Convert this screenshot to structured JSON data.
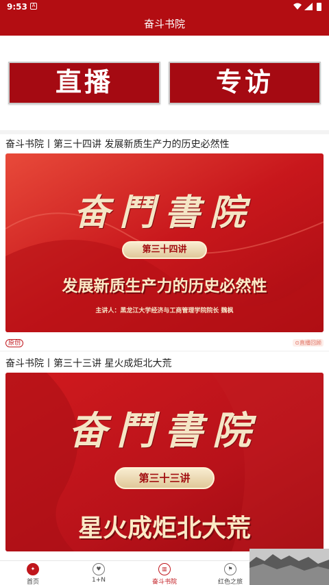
{
  "status": {
    "time": "9:53",
    "notif_icon": "A"
  },
  "header": {
    "title": "奋斗书院"
  },
  "buttons": {
    "live": "直播",
    "interview": "专访"
  },
  "articles": [
    {
      "title": "奋斗书院丨第三十四讲 发展新质生产力的历史必然性",
      "calligraphy": "奋鬥書院",
      "lecture": "第三十四讲",
      "subject": "发展新质生产力的历史必然性",
      "speaker": "主讲人：黑龙江大学经济与工商管理学院院长 魏枫",
      "tag_original": "原创",
      "tag_replay": "直播回顾"
    },
    {
      "title": "奋斗书院丨第三十三讲 星火成炬北大荒",
      "calligraphy": "奋鬥書院",
      "lecture": "第三十三讲",
      "subject": "星火成炬北大荒"
    }
  ],
  "tabbar": {
    "home": "首页",
    "one_plus_n": "1+N",
    "academy": "奋斗书院",
    "red_tour": "红色之旅"
  },
  "colors": {
    "brand_red": "#b30d12",
    "banner_red": "#c8171c",
    "gold": "#f5e6c6"
  }
}
